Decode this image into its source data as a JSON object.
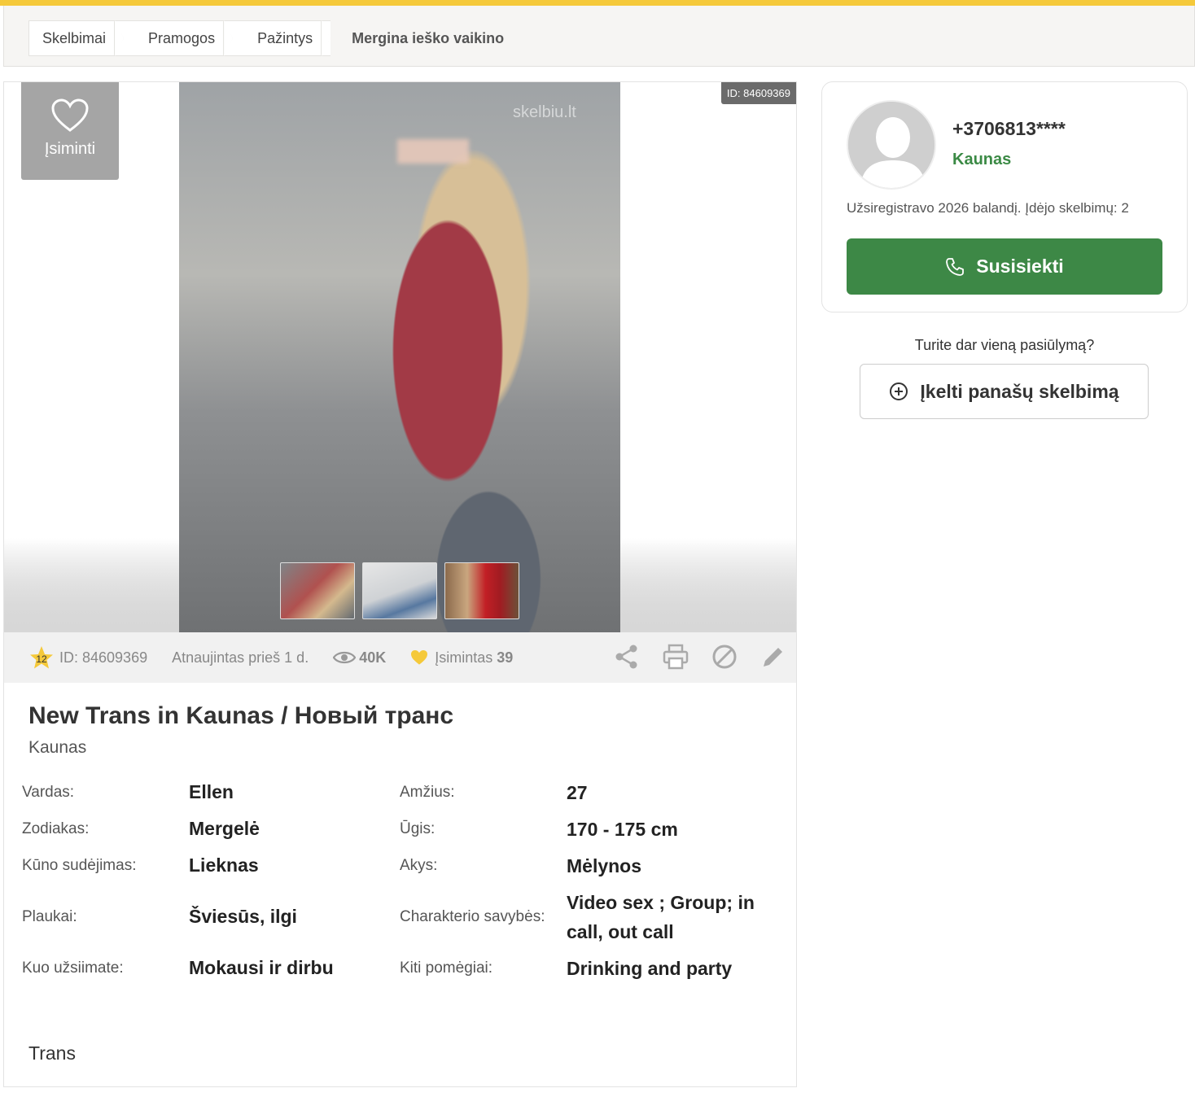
{
  "breadcrumb": {
    "items": [
      "Skelbimai",
      "Pramogos",
      "Pažintys"
    ],
    "current": "Mergina ieško vaikino"
  },
  "gallery": {
    "id_tag": "ID: 84609369",
    "remember_label": "Įsiminti",
    "watermark": "skelbiu.lt",
    "thumbnails": 3
  },
  "stats": {
    "star_count": "12",
    "id": "ID: 84609369",
    "updated": "Atnaujintas prieš 1 d.",
    "views": "40K",
    "remembered_label": "Įsimintas",
    "remembered_count": "39"
  },
  "listing": {
    "title": "New Trans in Kaunas / Новый транс",
    "city": "Kaunas",
    "attributes": [
      {
        "label": "Vardas:",
        "value": "Ellen",
        "label2": "Amžius:",
        "value2": "27"
      },
      {
        "label": "Zodiakas:",
        "value": "Mergelė",
        "label2": "Ūgis:",
        "value2": "170 - 175 cm"
      },
      {
        "label": "Kūno sudėjimas:",
        "value": "Lieknas",
        "label2": "Akys:",
        "value2": "Mėlynos"
      },
      {
        "label": "Plaukai:",
        "value": "Šviesūs, ilgi",
        "label2": "Charakterio savybės:",
        "value2": "Video sex ; Group; in call, out call"
      },
      {
        "label": "Kuo užsiimate:",
        "value": "Mokausi ir dirbu",
        "label2": "Kiti pomėgiai:",
        "value2": "Drinking and party"
      }
    ],
    "tag": "Trans"
  },
  "seller": {
    "phone": "+3706813****",
    "city": "Kaunas",
    "registered": "Užsiregistravo 2026 balandį. Įdėjo skelbimų: 2",
    "contact_label": "Susisiekti"
  },
  "offer": {
    "question": "Turite dar vieną pasiūlymą?",
    "upload_label": "Įkelti panašų skelbimą"
  },
  "colors": {
    "accent_yellow": "#f5c93a",
    "brand_green": "#3d8846",
    "city_green": "#3b8a45"
  }
}
